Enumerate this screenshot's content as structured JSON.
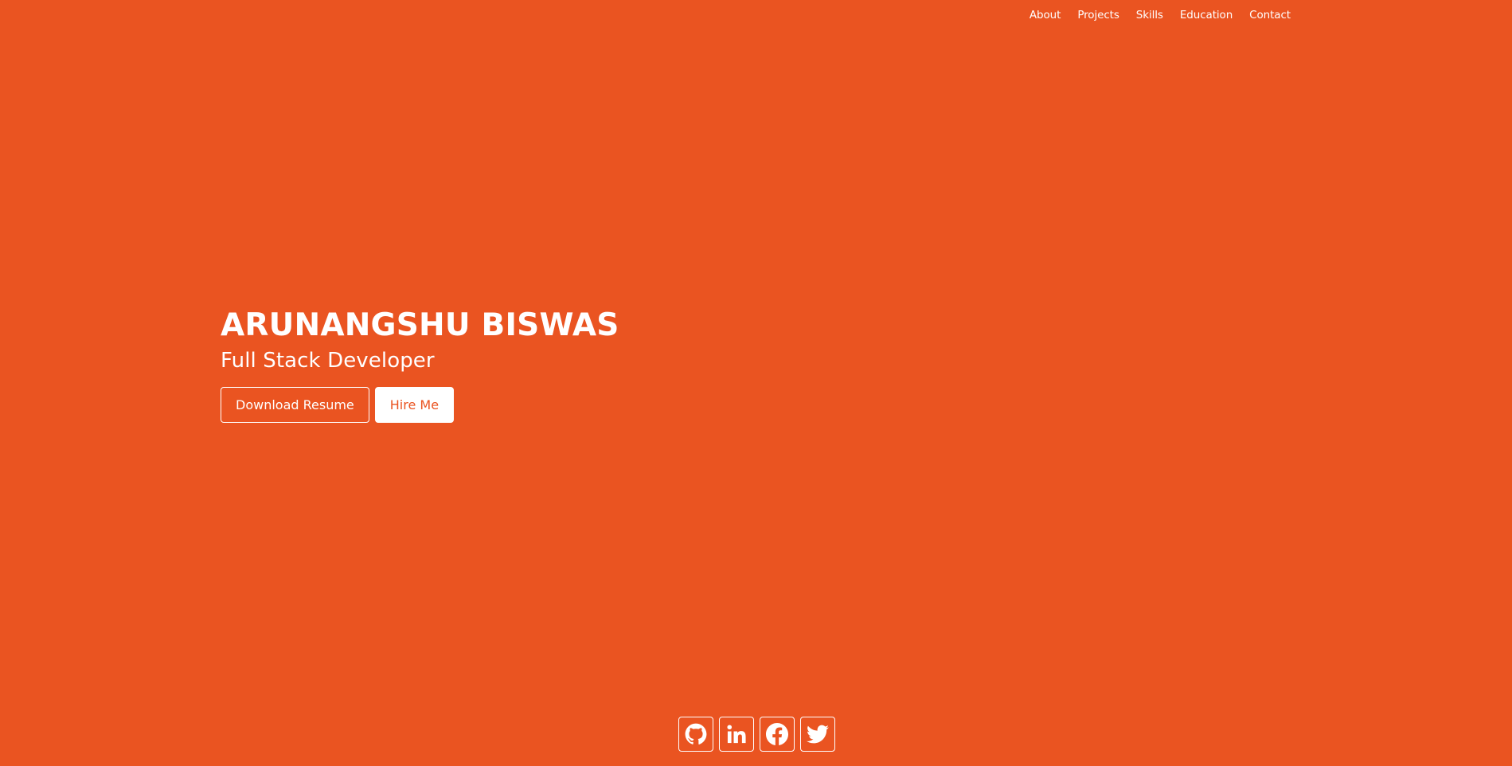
{
  "nav": {
    "items": [
      "About",
      "Projects",
      "Skills",
      "Education",
      "Contact"
    ]
  },
  "hero": {
    "name": "ARUNANGSHU BISWAS",
    "title": "Full Stack Developer",
    "download_label": "Download Resume",
    "hire_label": "Hire Me"
  },
  "social": {
    "icons": [
      "github-icon",
      "linkedin-icon",
      "facebook-icon",
      "twitter-icon"
    ]
  },
  "colors": {
    "background": "#ea5421",
    "foreground": "#ffffff"
  }
}
